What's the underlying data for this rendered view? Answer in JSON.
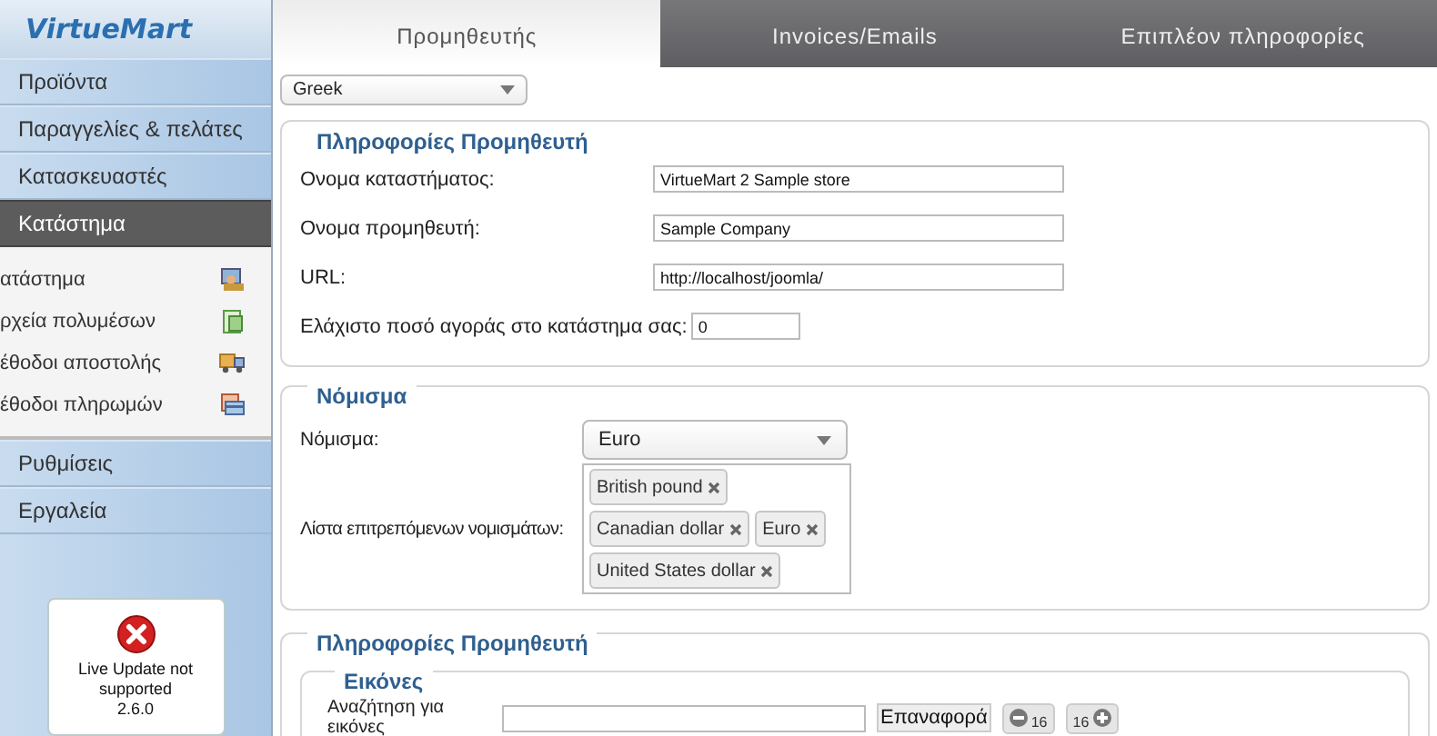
{
  "logo": {
    "text": "VirtueMart"
  },
  "sidebar": {
    "items": [
      {
        "label": "Προϊόντα",
        "selected": false
      },
      {
        "label": "Παραγγελίες & πελάτες",
        "selected": false
      },
      {
        "label": "Κατασκευαστές",
        "selected": false
      },
      {
        "label": "Κατάστημα",
        "selected": true,
        "children": [
          {
            "label": "ατάστημα"
          },
          {
            "label": "ρχεία πολυμέσων"
          },
          {
            "label": "έθοδοι αποστολής"
          },
          {
            "label": "έθοδοι πληρωμών"
          }
        ]
      },
      {
        "label": "Ρυθμίσεις",
        "selected": false
      },
      {
        "label": "Εργαλεία",
        "selected": false
      }
    ]
  },
  "live_update": {
    "message": "Live Update not supported",
    "version": "2.6.0"
  },
  "tabs": [
    {
      "label": "Προμηθευτής",
      "selected": true
    },
    {
      "label": "Invoices/Emails",
      "selected": false
    },
    {
      "label": "Επιπλέον πληροφορίες",
      "selected": false
    }
  ],
  "language_select": {
    "value": "Greek"
  },
  "vendor_info": {
    "title": "Πληροφορίες Προμηθευτή",
    "fields": [
      {
        "label": "Ονομα καταστήματος:",
        "value": "VirtueMart 2 Sample store",
        "kind": "wide"
      },
      {
        "label": "Ονομα προμηθευτή:",
        "value": "Sample Company",
        "kind": "wide"
      },
      {
        "label": "URL:",
        "value": "http://localhost/joomla/",
        "kind": "wide"
      },
      {
        "label": "Ελάχιστο ποσό αγοράς στο κατάστημα σας:",
        "value": "0",
        "kind": "short"
      }
    ]
  },
  "currency": {
    "title": "Νόμισμα",
    "currency_label": "Νόμισμα:",
    "currency_value": "Euro",
    "accepted_label": "Λίστα επιτρεπόμενων νομισμάτων:",
    "accepted": [
      "British pound",
      "Canadian dollar",
      "Euro",
      "United States dollar"
    ]
  },
  "images_section": {
    "title": "Πληροφορίες Προμηθευτή",
    "subtitle": "Εικόνες",
    "search_label": "Αναζήτηση για εικόνες",
    "reset_button": "Επαναφορά",
    "prev_count": "16",
    "next_count": "16"
  }
}
